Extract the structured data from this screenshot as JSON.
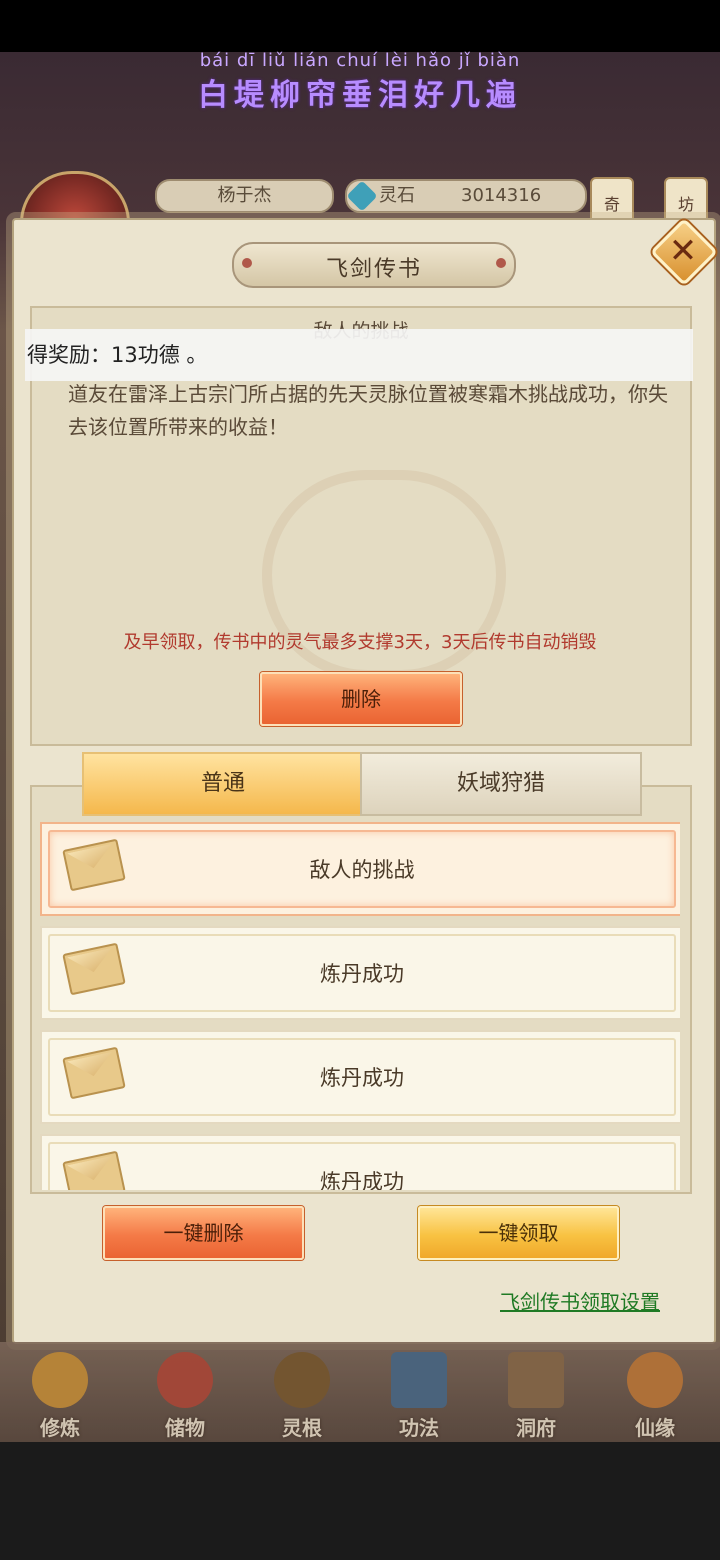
{
  "lyric": {
    "pinyin": "bái dī liǔ lián chuí lèi hǎo jǐ biàn",
    "text": "白堤柳帘垂泪好几遍"
  },
  "hud": {
    "player_name": "杨于杰",
    "stone_label": "灵石",
    "stone_value": "3014316",
    "side_buttons": [
      "奇",
      "坊"
    ]
  },
  "panel": {
    "title": "飞剑传书",
    "close_icon": "close-icon"
  },
  "message": {
    "title": "敌人的挑战",
    "body": "道友在雷泽上古宗门所占据的先天灵脉位置被寒霜木挑战成功，你失去该位置所带来的收益！",
    "warning": "及早领取，传书中的灵气最多支撑3天，3天后传书自动销毁",
    "delete_label": "删除"
  },
  "toast": "得奖励：13功德 。",
  "tabs": [
    {
      "label": "普通",
      "active": true
    },
    {
      "label": "妖域狩猎",
      "active": false
    }
  ],
  "list": [
    {
      "label": "敌人的挑战",
      "icon": "envelope-icon",
      "active": true
    },
    {
      "label": "炼丹成功",
      "icon": "envelope-icon",
      "active": false
    },
    {
      "label": "炼丹成功",
      "icon": "envelope-icon",
      "active": false
    },
    {
      "label": "炼丹成功",
      "icon": "envelope-icon",
      "active": false
    }
  ],
  "actions": {
    "delete_all": "一键删除",
    "claim_all": "一键领取",
    "settings_link": "飞剑传书领取设置"
  },
  "nav": [
    {
      "label": "修炼",
      "icon": "meditating-monk-icon",
      "color": "#c8903a"
    },
    {
      "label": "储物",
      "icon": "treasure-bag-icon",
      "color": "#b04a3a"
    },
    {
      "label": "灵根",
      "icon": "spirit-root-icon",
      "color": "#7a5a30"
    },
    {
      "label": "功法",
      "icon": "scripture-book-icon",
      "color": "#4a6a8a"
    },
    {
      "label": "洞府",
      "icon": "cave-mansion-icon",
      "color": "#8a6a4a"
    },
    {
      "label": "仙缘",
      "icon": "immortal-fate-icon",
      "color": "#c07a3a"
    }
  ]
}
